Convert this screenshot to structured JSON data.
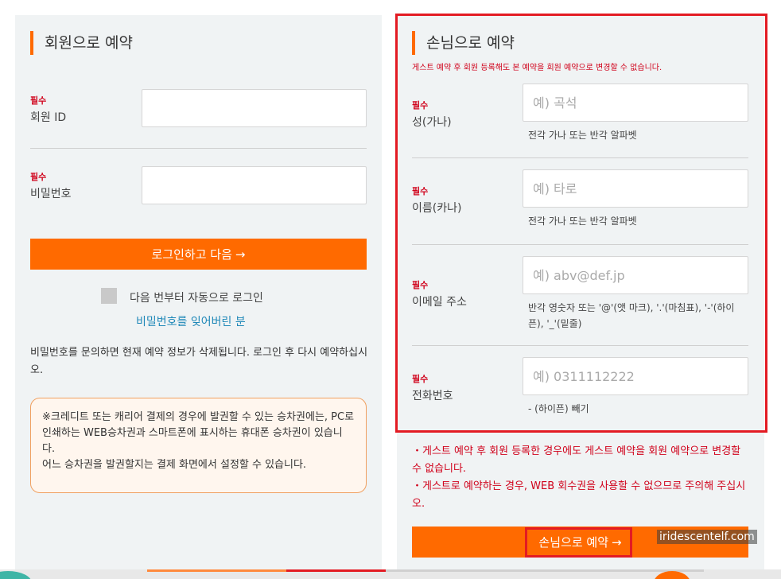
{
  "member": {
    "title": "회원으로 예약",
    "required": "필수",
    "id_label": "회원 ID",
    "password_label": "비밀번호",
    "login_button": "로그인하고 다음",
    "arrow": "→",
    "auto_login": "다음 번부터 자동으로 로그인",
    "forgot_password": "비밀번호를 잊어버린 분",
    "notice": "비밀번호를 문의하면 현재 예약 정보가 삭제됩니다. 로그인 후 다시 예약하십시오.",
    "info_box": "※크레디트 또는 캐리어 결제의 경우에 발권할 수 있는 승차권에는, PC로 인쇄하는 WEB승차권과 스마트폰에 표시하는 휴대폰 승차권이 있습니다.\n어느 승차권을 발권할지는 결제 화면에서 설정할 수 있습니다."
  },
  "guest": {
    "title": "손님으로 예약",
    "warning": "게스트 예약 후 회원 등록해도 본 예약을 회원 예약으로 변경할 수 없습니다.",
    "required": "필수",
    "fields": [
      {
        "label": "성(가나)",
        "placeholder": "예) 곡석",
        "hint": "전각 가나 또는 반각 알파벳"
      },
      {
        "label": "이름(카나)",
        "placeholder": "예) 타로",
        "hint": "전각 가나 또는 반각 알파벳"
      },
      {
        "label": "이메일 주소",
        "placeholder": "예) abv@def.jp",
        "hint": "반각 영숫자 또는 '@'(앳 마크), '.'(마침표), '-'(하이픈), '_'(밑줄)"
      },
      {
        "label": "전화번호",
        "placeholder": "예) 0311112222",
        "hint": "- (하이픈) 빼기"
      }
    ],
    "notes": [
      "・게스트 예약 후 회원 등록한 경우에도 게스트 예약을 회원 예약으로 변경할 수 없습니다.",
      "・게스트로 예약하는 경우, WEB 회수권을 사용할 수 없으므로 주의해 주십시오."
    ],
    "submit_button": "손님으로 예약",
    "arrow": "→"
  },
  "watermark": "iridescentelf.com"
}
